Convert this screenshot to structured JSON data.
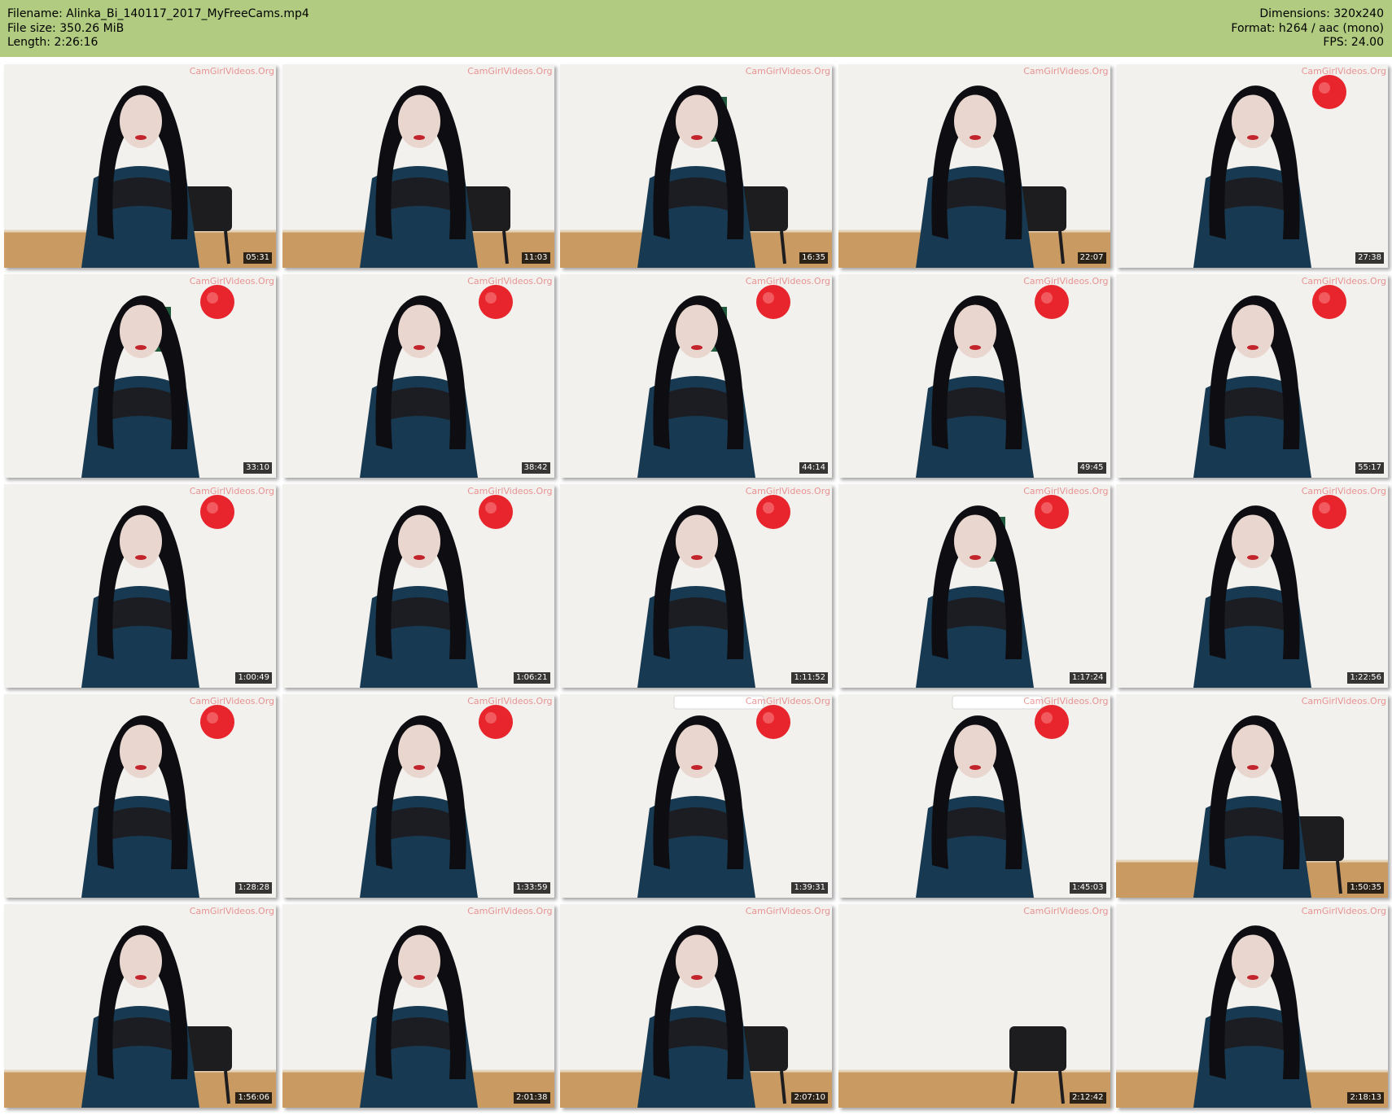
{
  "header": {
    "filename": "Filename: Alinka_Bi_140117_2017_MyFreeCams.mp4",
    "filesize": "File size: 350.26 MiB",
    "length": "Length: 2:26:16",
    "dimensions": "Dimensions: 320x240",
    "format": "Format: h264 / aac (mono)",
    "fps": "FPS: 24.00"
  },
  "colors": {
    "header_bg": "#b1cc80",
    "stamp_bg": "#000000",
    "stamp_text": "#ffffff"
  },
  "watermark": "CamGirlVideos.Org",
  "thumbnails": [
    {
      "time": "05:31",
      "scene": "seated-chair"
    },
    {
      "time": "11:03",
      "scene": "seated-chair"
    },
    {
      "time": "16:35",
      "scene": "poster-chair"
    },
    {
      "time": "22:07",
      "scene": "chair"
    },
    {
      "time": "27:38",
      "scene": "flower"
    },
    {
      "time": "33:10",
      "scene": "poster-flower"
    },
    {
      "time": "38:42",
      "scene": "flower"
    },
    {
      "time": "44:14",
      "scene": "poster-flower"
    },
    {
      "time": "49:45",
      "scene": "flower"
    },
    {
      "time": "55:17",
      "scene": "flower"
    },
    {
      "time": "1:00:49",
      "scene": "flower"
    },
    {
      "time": "1:06:21",
      "scene": "flower"
    },
    {
      "time": "1:11:52",
      "scene": "flower"
    },
    {
      "time": "1:17:24",
      "scene": "poster-flower"
    },
    {
      "time": "1:22:56",
      "scene": "flower"
    },
    {
      "time": "1:28:28",
      "scene": "flower"
    },
    {
      "time": "1:33:59",
      "scene": "flower"
    },
    {
      "time": "1:39:31",
      "scene": "ac-flower"
    },
    {
      "time": "1:45:03",
      "scene": "ac-flower"
    },
    {
      "time": "1:50:35",
      "scene": "chair-floor"
    },
    {
      "time": "1:56:06",
      "scene": "chair-floor"
    },
    {
      "time": "2:01:38",
      "scene": "seated"
    },
    {
      "time": "2:07:10",
      "scene": "phone-chair"
    },
    {
      "time": "2:12:42",
      "scene": "empty-chair"
    },
    {
      "time": "2:18:13",
      "scene": "seated"
    }
  ]
}
